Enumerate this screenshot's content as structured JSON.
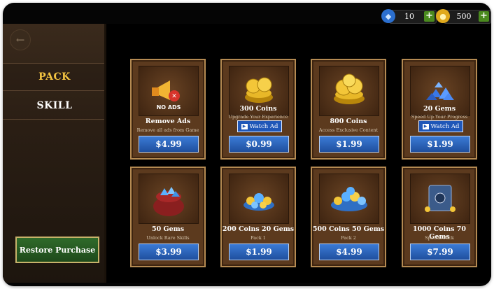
{
  "sidebar": {
    "menu": [
      {
        "label": "PACK",
        "active": true
      },
      {
        "label": "SKILL",
        "active": false
      }
    ],
    "restore_label": "Restore Purchase"
  },
  "resources": [
    {
      "icon": "diamond-icon",
      "value": "10"
    },
    {
      "icon": "coin-icon",
      "value": "500"
    }
  ],
  "cards": [
    {
      "art": "megaphone-no-ads",
      "art_text": "NO ADS",
      "title": "Remove Ads",
      "subtitle": "Remove all ads from Game",
      "watch_ad": "",
      "price": "$4.99"
    },
    {
      "art": "gold-coins",
      "art_text": "",
      "title": "300 Coins",
      "subtitle": "Upgrade Your Experience",
      "watch_ad": "Watch Ad",
      "price": "$0.99"
    },
    {
      "art": "gold-coins",
      "art_text": "",
      "title": "800 Coins",
      "subtitle": "Access Exclusive Content",
      "watch_ad": "",
      "price": "$1.99"
    },
    {
      "art": "blue-gems",
      "art_text": "",
      "title": "20 Gems",
      "subtitle": "Speed Up Your Progress",
      "watch_ad": "Watch Ad",
      "price": "$1.99"
    },
    {
      "art": "gem-sack",
      "art_text": "",
      "title": "50 Gems",
      "subtitle": "Unlock Rare Skills",
      "watch_ad": "",
      "price": "$3.99"
    },
    {
      "art": "coins-gems-pile",
      "art_text": "",
      "title": "200 Coins 20 Gems",
      "subtitle": "Pack 1",
      "watch_ad": "",
      "price": "$1.99"
    },
    {
      "art": "coins-gems-pile",
      "art_text": "",
      "title": "500 Coins 50 Gems",
      "subtitle": "Pack 2",
      "watch_ad": "",
      "price": "$4.99"
    },
    {
      "art": "treasure-safe",
      "art_text": "",
      "title": "1000 Coins 70 Gems",
      "subtitle": "Special Pack",
      "watch_ad": "",
      "price": "$7.99"
    }
  ],
  "colors": {
    "accent_gold": "#f4c542",
    "price_blue": "#2a63c0",
    "restore_green": "#2f6a2a"
  }
}
